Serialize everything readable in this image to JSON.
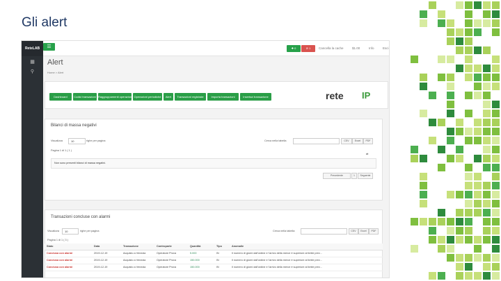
{
  "slide": {
    "title": "Gli alert"
  },
  "app": {
    "brand": "ReteLAB",
    "topbar": {
      "green_badge": "✚ 0",
      "red_badge": "⊘ 1",
      "links": [
        "Cancella la cache",
        "$1.00",
        "Info",
        "Esci"
      ]
    },
    "page_title": "Alert",
    "breadcrumb": "Home  >  Alert",
    "nav_buttons": [
      "Dashboard",
      "Codici transazioni",
      "Raggruppamenti operazioni",
      "Operazioni periodiche",
      "Alert",
      "Transazioni registrate",
      "Importa transazioni",
      "Inserisci transazione"
    ],
    "logo": {
      "rete": "rete",
      "ip": "IP"
    },
    "section1": {
      "title": "Bilanci di massa negativi",
      "show_label": "Visualizza",
      "show_value": "10",
      "rows_label": "righe per pagina",
      "search_label": "Cerca nella tabella",
      "export": [
        "CSV",
        "Excel",
        "PDF"
      ],
      "paging_info": "Pagina 1 di 1 ( 1 )",
      "empty_message": "Non sono presenti bilanci di massa negativi.",
      "prev": "Precedente",
      "page": "1",
      "next": "Seguente"
    },
    "section2": {
      "title": "Transazioni concluse con alarmi",
      "show_label": "Visualizza",
      "show_value": "10",
      "rows_label": "righe per pagina",
      "search_label": "Cerca nella tabella",
      "export": [
        "CSV",
        "Excel",
        "PDF"
      ],
      "paging_info": "Pagina 1 di 1 ( 3 )",
      "columns": [
        "Stato",
        "Data",
        "Transazione",
        "Controparte",
        "Quantità",
        "Tipo",
        "Anomalie"
      ],
      "rows": [
        [
          "Conclusa con alarmi",
          "2019-12-19",
          "Acquisto a Venezia",
          "Operatore Prova",
          "5.000",
          "IN",
          "Il numero di giorni dall'ordine e l'arrivo della merce è superiore al limite prev..."
        ],
        [
          "Conclusa con alarmi",
          "2019-12-19",
          "Acquisto a Venezia",
          "Operatore Prova",
          "150.000",
          "IN",
          "Il numero di giorni dall'ordine e l'arrivo della merce è superiore al limite prev..."
        ],
        [
          "Conclusa con alarmi",
          "2019-12-19",
          "Acquisto a Venezia",
          "Operatore Prova",
          "150.000",
          "IN",
          "Il numero di giorni dall'ordine e l'arrivo della merce è superiore al limite prev..."
        ]
      ]
    }
  },
  "colors": {
    "green": "#27a14a",
    "red": "#d9534f",
    "sidebar": "#2b3035",
    "title": "#1f3864"
  }
}
